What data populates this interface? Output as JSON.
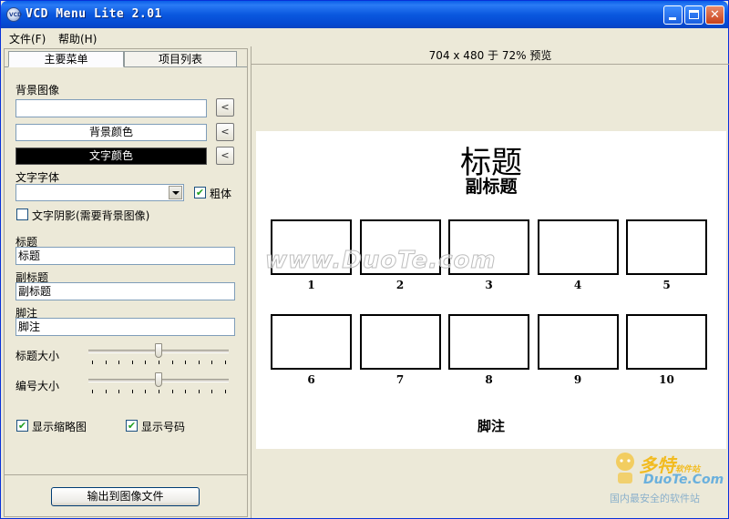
{
  "window": {
    "title": "VCD Menu Lite 2.01",
    "icon_text": "VCD"
  },
  "menubar": {
    "file": "文件(F)",
    "help": "帮助(H)"
  },
  "tabs": {
    "main_menu": "主要菜单",
    "item_list": "项目列表"
  },
  "left": {
    "bg_image_label": "背景图像",
    "bg_image_value": "",
    "bg_color_label": "背景颜色",
    "text_color_label": "文字颜色",
    "browse_symbol": "<",
    "font_label": "文字字体",
    "font_value": "",
    "bold_label": "粗体",
    "bold_checked": "✔",
    "shadow_label": "文字阴影(需要背景图像)",
    "title_label": "标题",
    "title_value": "标题",
    "subtitle_label": "副标题",
    "subtitle_value": "副标题",
    "footer_label": "脚注",
    "footer_value": "脚注",
    "title_size_label": "标题大小",
    "number_size_label": "编号大小",
    "title_size_level": 0.5,
    "number_size_level": 0.5,
    "show_thumbs_label": "显示缩略图",
    "show_numbers_label": "显示号码",
    "check_mark": "✔",
    "export_button": "输出到图像文件"
  },
  "preview": {
    "header": "704 x 480 于 72% 预览",
    "title": "标题",
    "subtitle": "副标题",
    "footer": "脚注",
    "numbers": [
      "1",
      "2",
      "3",
      "4",
      "5",
      "6",
      "7",
      "8",
      "9",
      "10"
    ]
  },
  "watermark": {
    "center": "www.DuoTe.com",
    "brand": "多特",
    "brand_suffix": "软件站",
    "url": "DuoTe.Com",
    "tagline": "国内最安全的软件站"
  },
  "colors": {
    "titlebar": "#0a58df",
    "window_bg": "#ece9d8",
    "text_color_swatch": "#000000"
  }
}
